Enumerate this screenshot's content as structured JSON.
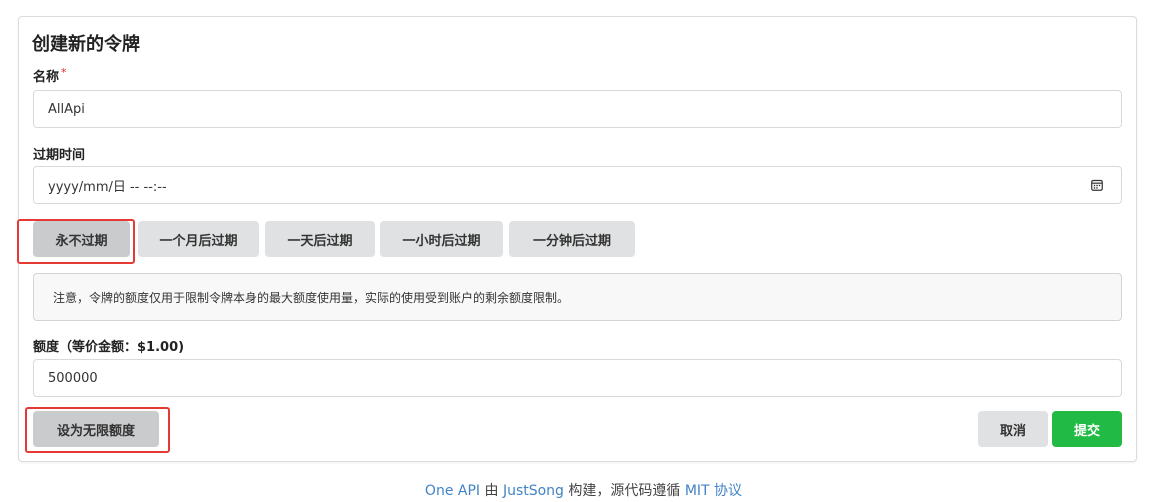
{
  "form": {
    "title": "创建新的令牌",
    "name_label": "名称",
    "required_mark": "*",
    "name_value": "AllApi",
    "expire_label": "过期时间",
    "expire_value": "yyyy/mm/日 -- --:--",
    "expire_buttons": [
      "永不过期",
      "一个月后过期",
      "一天后过期",
      "一小时后过期",
      "一分钟后过期"
    ],
    "notice": "注意，令牌的额度仅用于限制令牌本身的最大额度使用量，实际的使用受到账户的剩余额度限制。",
    "quota_label": "额度（等价金额：$1.00)",
    "quota_value": "500000",
    "unlimited_button": "设为无限额度",
    "cancel_button": "取消",
    "submit_button": "提交"
  },
  "footer": {
    "app_name": "One API",
    "by": " 由 ",
    "author": "JustSong",
    "built": " 构建，源代码遵循 ",
    "license": "MIT 协议"
  },
  "icons": {
    "calendar": "calendar-icon"
  },
  "colors": {
    "highlight": "#e53935",
    "submit": "#21ba45",
    "link": "#4183c4"
  }
}
